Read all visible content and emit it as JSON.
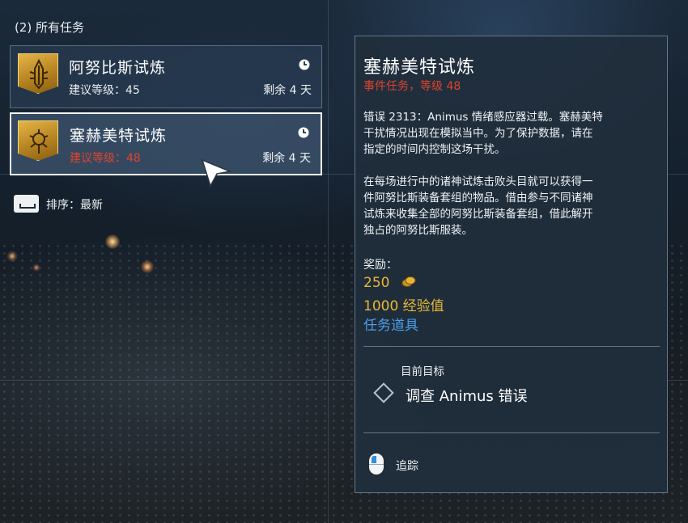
{
  "list": {
    "header": "(2) 所有任务",
    "quests": [
      {
        "title": "阿努比斯试炼",
        "level": "建议等级：45",
        "remaining": "剩余 4 天",
        "icon": "anubis-emblem-icon",
        "selected": false
      },
      {
        "title": "塞赫美特试炼",
        "level": "建议等级：48",
        "remaining": "剩余 4 天",
        "icon": "sekhmet-emblem-icon",
        "selected": true
      }
    ],
    "sort": {
      "key_icon": "spacebar-key-icon",
      "label": "排序：最新"
    }
  },
  "detail": {
    "title": "塞赫美特试炼",
    "subtitle": "事件任务，等级 48",
    "description": "错误 2313：Animus 情绪感应器过载。塞赫美特\n干扰情况出现在模拟当中。为了保护数据，请在\n指定的时间内控制这场干扰。\n\n在每场进行中的诸神试炼击败头目就可以获得一\n件阿努比斯装备套组的物品。借由参与不同诸神\n试炼来收集全部的阿努比斯装备套组，借此解开\n独占的阿努比斯服装。",
    "rewards_heading": "奖励：",
    "reward_money": "250",
    "reward_xp": "1000 经验值",
    "reward_item": "任务道具",
    "objective_heading": "目前目标",
    "objective_text": "调查 Animus 错误",
    "track_label": "追踪"
  },
  "colors": {
    "warning_red": "#e0432c",
    "reward_gold": "#e8b637",
    "reward_blue": "#4a9fe8",
    "emblem_gold": "#d9a53a"
  }
}
